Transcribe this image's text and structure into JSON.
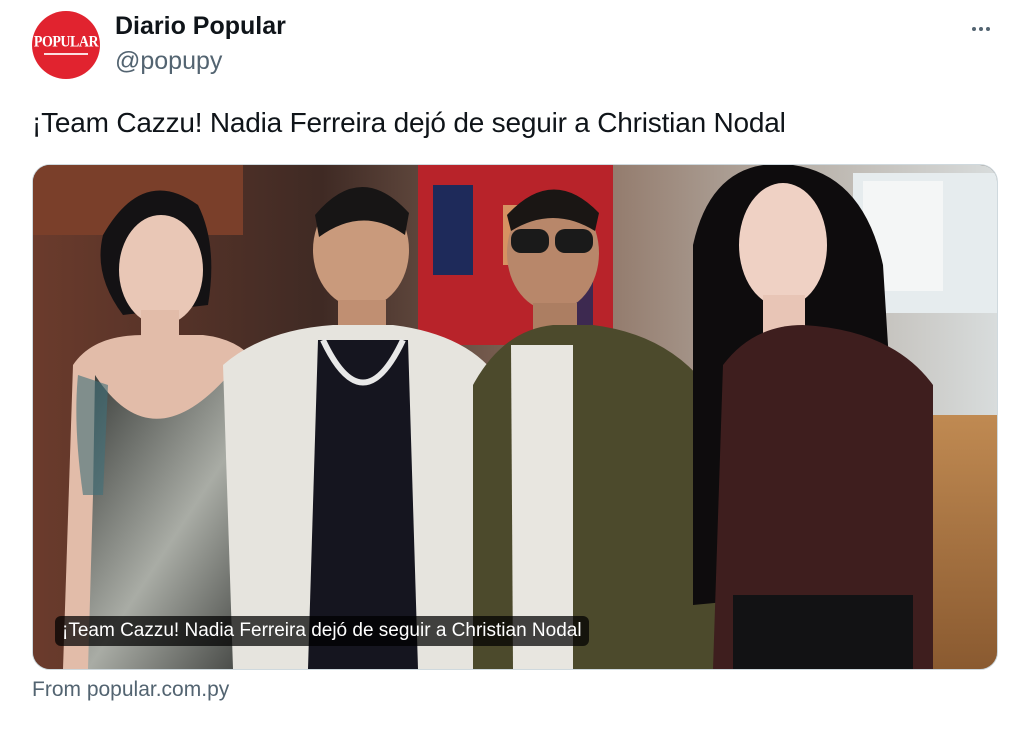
{
  "account": {
    "name": "Diario Popular",
    "handle": "@popupy",
    "avatar_text": "POPULAR",
    "avatar_color": "#e1232f"
  },
  "tweet": {
    "text": "¡Team Cazzu! Nadia Ferreira dejó de seguir a Christian Nodal",
    "more_icon": "more-horizontal-icon"
  },
  "card": {
    "image_caption": "¡Team Cazzu! Nadia Ferreira dejó de seguir a Christian Nodal",
    "source": "From popular.com.py"
  },
  "colors": {
    "text_primary": "#0f1419",
    "text_secondary": "#536471",
    "border": "#cfd9de"
  }
}
